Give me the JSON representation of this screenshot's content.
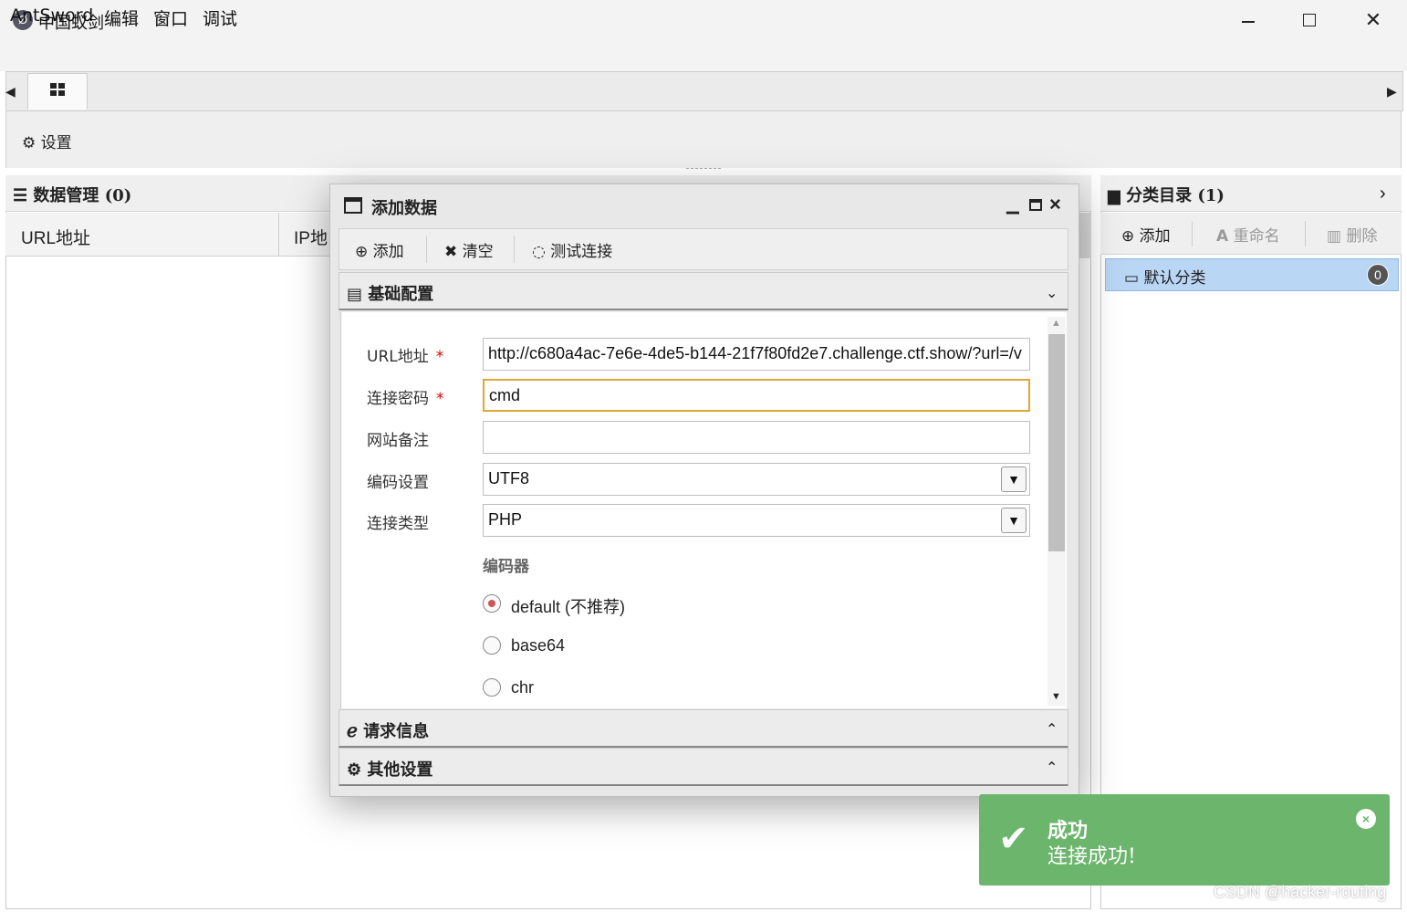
{
  "window": {
    "title": "中国蚁剑",
    "app_icon_glyph": "Ø"
  },
  "menubar": {
    "items": [
      "AntSword",
      "编辑",
      "窗口",
      "调试"
    ]
  },
  "toolbar": {
    "settings_label": "设置",
    "settings_icon": "gear-icon"
  },
  "data_panel": {
    "header": "数据管理 (0)",
    "columns": [
      "URL地址",
      "IP地址"
    ],
    "column_visible_text": [
      "URL地址",
      "IP地"
    ]
  },
  "category_panel": {
    "header": "分类目录 (1)",
    "tools": {
      "add": "添加",
      "rename": "重命名",
      "delete": "删除"
    },
    "items": [
      {
        "label": "默认分类",
        "count": "0"
      }
    ]
  },
  "dialog": {
    "title": "添加数据",
    "toolbar": {
      "add": "添加",
      "clear": "清空",
      "test": "测试连接"
    },
    "sections": {
      "basic": "基础配置",
      "request": "请求信息",
      "other": "其他设置"
    },
    "form": {
      "url_label": "URL地址",
      "url_value": "http://c680a4ac-7e6e-4de5-b144-21f7f80fd2e7.challenge.ctf.show/?url=/v",
      "password_label": "连接密码",
      "password_value": "cmd",
      "note_label": "网站备注",
      "note_value": "",
      "encoding_label": "编码设置",
      "encoding_value": "UTF8",
      "type_label": "连接类型",
      "type_value": "PHP",
      "required_mark": "*",
      "encoder_label": "编码器",
      "encoders": [
        {
          "label": "default (不推荐)",
          "checked": true
        },
        {
          "label": "base64",
          "checked": false
        },
        {
          "label": "chr",
          "checked": false
        }
      ]
    }
  },
  "toast": {
    "title": "成功",
    "message": "连接成功!",
    "color": "#6bb56c"
  },
  "watermark": "CSDN @hacker-routing"
}
